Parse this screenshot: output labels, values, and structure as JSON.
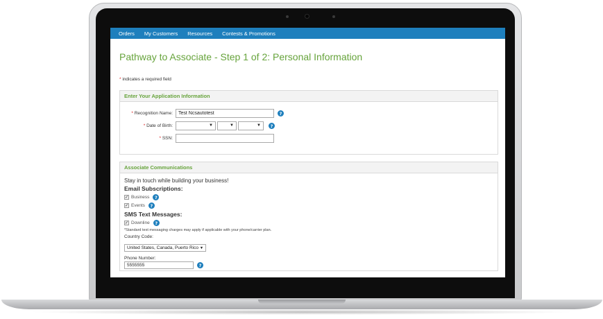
{
  "nav": {
    "items": [
      "Orders",
      "My Customers",
      "Resources",
      "Contests & Promotions"
    ]
  },
  "page": {
    "title": "Pathway to Associate - Step 1 of 2: Personal Information",
    "required_star": "*",
    "required_note": "indicates a required field"
  },
  "application_panel": {
    "heading": "Enter Your Application Information",
    "recognition_label": "Recognition Name:",
    "recognition_value": "Test Ncsautotest",
    "dob_label": "Date of Birth:",
    "ssn_label": "SSN:",
    "ssn_value": ""
  },
  "comm_panel": {
    "heading": "Associate Communications",
    "intro": "Stay in touch while building your business!",
    "email_heading": "Email Subscriptions:",
    "email_options": [
      "Business",
      "Events"
    ],
    "sms_heading": "SMS Text Messages:",
    "sms_options": [
      "Downline"
    ],
    "fine_print": "*Standard text messaging charges may apply if applicable with your phone/carrier plan.",
    "country_label": "Country Code:",
    "country_value": "United States, Canada, Puerto Rico",
    "phone_label": "Phone Number:",
    "phone_value": "5555555"
  },
  "icons": {
    "help": "?",
    "check": "✓",
    "dropdown": "▼"
  },
  "colors": {
    "nav_bg": "#1e7fbd",
    "title_green": "#66a33b",
    "required_red": "#d22222"
  }
}
